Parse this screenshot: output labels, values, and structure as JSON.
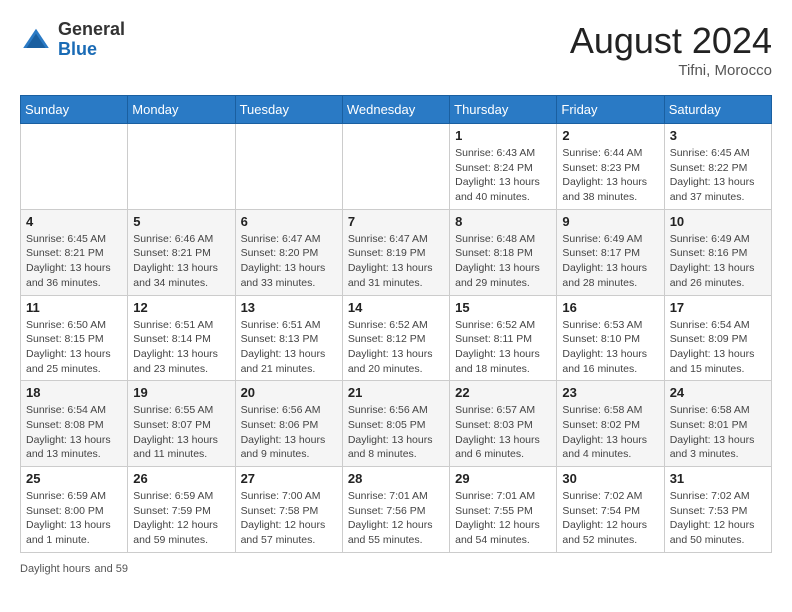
{
  "header": {
    "logo_line1": "General",
    "logo_line2": "Blue",
    "month_year": "August 2024",
    "location": "Tifni, Morocco"
  },
  "days_of_week": [
    "Sunday",
    "Monday",
    "Tuesday",
    "Wednesday",
    "Thursday",
    "Friday",
    "Saturday"
  ],
  "weeks": [
    [
      {
        "day": "",
        "info": ""
      },
      {
        "day": "",
        "info": ""
      },
      {
        "day": "",
        "info": ""
      },
      {
        "day": "",
        "info": ""
      },
      {
        "day": "1",
        "info": "Sunrise: 6:43 AM\nSunset: 8:24 PM\nDaylight: 13 hours and 40 minutes."
      },
      {
        "day": "2",
        "info": "Sunrise: 6:44 AM\nSunset: 8:23 PM\nDaylight: 13 hours and 38 minutes."
      },
      {
        "day": "3",
        "info": "Sunrise: 6:45 AM\nSunset: 8:22 PM\nDaylight: 13 hours and 37 minutes."
      }
    ],
    [
      {
        "day": "4",
        "info": "Sunrise: 6:45 AM\nSunset: 8:21 PM\nDaylight: 13 hours and 36 minutes."
      },
      {
        "day": "5",
        "info": "Sunrise: 6:46 AM\nSunset: 8:21 PM\nDaylight: 13 hours and 34 minutes."
      },
      {
        "day": "6",
        "info": "Sunrise: 6:47 AM\nSunset: 8:20 PM\nDaylight: 13 hours and 33 minutes."
      },
      {
        "day": "7",
        "info": "Sunrise: 6:47 AM\nSunset: 8:19 PM\nDaylight: 13 hours and 31 minutes."
      },
      {
        "day": "8",
        "info": "Sunrise: 6:48 AM\nSunset: 8:18 PM\nDaylight: 13 hours and 29 minutes."
      },
      {
        "day": "9",
        "info": "Sunrise: 6:49 AM\nSunset: 8:17 PM\nDaylight: 13 hours and 28 minutes."
      },
      {
        "day": "10",
        "info": "Sunrise: 6:49 AM\nSunset: 8:16 PM\nDaylight: 13 hours and 26 minutes."
      }
    ],
    [
      {
        "day": "11",
        "info": "Sunrise: 6:50 AM\nSunset: 8:15 PM\nDaylight: 13 hours and 25 minutes."
      },
      {
        "day": "12",
        "info": "Sunrise: 6:51 AM\nSunset: 8:14 PM\nDaylight: 13 hours and 23 minutes."
      },
      {
        "day": "13",
        "info": "Sunrise: 6:51 AM\nSunset: 8:13 PM\nDaylight: 13 hours and 21 minutes."
      },
      {
        "day": "14",
        "info": "Sunrise: 6:52 AM\nSunset: 8:12 PM\nDaylight: 13 hours and 20 minutes."
      },
      {
        "day": "15",
        "info": "Sunrise: 6:52 AM\nSunset: 8:11 PM\nDaylight: 13 hours and 18 minutes."
      },
      {
        "day": "16",
        "info": "Sunrise: 6:53 AM\nSunset: 8:10 PM\nDaylight: 13 hours and 16 minutes."
      },
      {
        "day": "17",
        "info": "Sunrise: 6:54 AM\nSunset: 8:09 PM\nDaylight: 13 hours and 15 minutes."
      }
    ],
    [
      {
        "day": "18",
        "info": "Sunrise: 6:54 AM\nSunset: 8:08 PM\nDaylight: 13 hours and 13 minutes."
      },
      {
        "day": "19",
        "info": "Sunrise: 6:55 AM\nSunset: 8:07 PM\nDaylight: 13 hours and 11 minutes."
      },
      {
        "day": "20",
        "info": "Sunrise: 6:56 AM\nSunset: 8:06 PM\nDaylight: 13 hours and 9 minutes."
      },
      {
        "day": "21",
        "info": "Sunrise: 6:56 AM\nSunset: 8:05 PM\nDaylight: 13 hours and 8 minutes."
      },
      {
        "day": "22",
        "info": "Sunrise: 6:57 AM\nSunset: 8:03 PM\nDaylight: 13 hours and 6 minutes."
      },
      {
        "day": "23",
        "info": "Sunrise: 6:58 AM\nSunset: 8:02 PM\nDaylight: 13 hours and 4 minutes."
      },
      {
        "day": "24",
        "info": "Sunrise: 6:58 AM\nSunset: 8:01 PM\nDaylight: 13 hours and 3 minutes."
      }
    ],
    [
      {
        "day": "25",
        "info": "Sunrise: 6:59 AM\nSunset: 8:00 PM\nDaylight: 13 hours and 1 minute."
      },
      {
        "day": "26",
        "info": "Sunrise: 6:59 AM\nSunset: 7:59 PM\nDaylight: 12 hours and 59 minutes."
      },
      {
        "day": "27",
        "info": "Sunrise: 7:00 AM\nSunset: 7:58 PM\nDaylight: 12 hours and 57 minutes."
      },
      {
        "day": "28",
        "info": "Sunrise: 7:01 AM\nSunset: 7:56 PM\nDaylight: 12 hours and 55 minutes."
      },
      {
        "day": "29",
        "info": "Sunrise: 7:01 AM\nSunset: 7:55 PM\nDaylight: 12 hours and 54 minutes."
      },
      {
        "day": "30",
        "info": "Sunrise: 7:02 AM\nSunset: 7:54 PM\nDaylight: 12 hours and 52 minutes."
      },
      {
        "day": "31",
        "info": "Sunrise: 7:02 AM\nSunset: 7:53 PM\nDaylight: 12 hours and 50 minutes."
      }
    ]
  ],
  "footer": {
    "label": "Daylight hours",
    "note": "and 59"
  }
}
